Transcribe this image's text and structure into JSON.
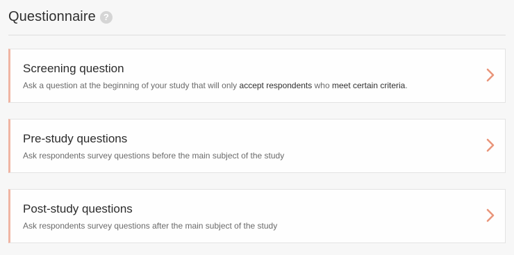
{
  "header": {
    "title": "Questionnaire",
    "help_icon": "help-question-icon",
    "help_glyph": "?"
  },
  "cards": [
    {
      "title": "Screening question",
      "desc_part1": "Ask a  question at the beginning of your study that will only ",
      "desc_strong1": "accept respondents",
      "desc_part2": " who ",
      "desc_strong2": "meet certain criteria",
      "desc_part3": "."
    },
    {
      "title": "Pre-study questions",
      "description": "Ask respondents survey questions before the main subject of the study"
    },
    {
      "title": "Post-study questions",
      "description": "Ask respondents survey questions after the main subject of the study"
    }
  ],
  "icons": {
    "chevron": "chevron-right-icon"
  },
  "colors": {
    "accent": "#f0b5a4",
    "chevron": "#e9957a",
    "background": "#f7f7f7"
  }
}
